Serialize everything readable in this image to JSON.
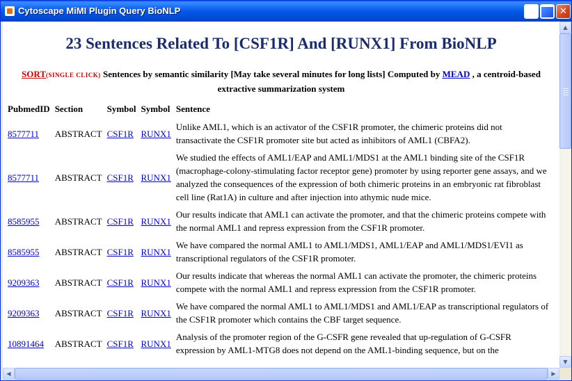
{
  "window": {
    "title": "Cytoscape MiMI Plugin Query BioNLP"
  },
  "page": {
    "heading": "23 Sentences Related To [CSF1R] And [RUNX1] From BioNLP",
    "sort_link": "SORT",
    "sort_note": "(SINGLE CLICK)",
    "sort_text": " Sentences by semantic similarity [May take several minutes for long lists] Computed by ",
    "mead_link": "MEAD",
    "sort_text2": " , a centroid-based extractive summarization system"
  },
  "table": {
    "headers": [
      "PubmedID",
      "Section",
      "Symbol",
      "Symbol",
      "Sentence"
    ],
    "rows": [
      {
        "pmid": "8577711",
        "section": "ABSTRACT",
        "sym1": "CSF1R",
        "sym2": "RUNX1",
        "sentence": "Unlike AML1, which is an activator of the CSF1R promoter, the chimeric proteins did not transactivate the CSF1R promoter site but acted as inhibitors of AML1 (CBFA2)."
      },
      {
        "pmid": "8577711",
        "section": "ABSTRACT",
        "sym1": "CSF1R",
        "sym2": "RUNX1",
        "sentence": "We studied the effects of AML1/EAP and AML1/MDS1 at the AML1 binding site of the CSF1R (macrophage-colony-stimulating factor receptor gene) promoter by using reporter gene assays, and we analyzed the consequences of the expression of both chimeric proteins in an embryonic rat fibroblast cell line (Rat1A) in culture and after injection into athymic nude mice."
      },
      {
        "pmid": "8585955",
        "section": "ABSTRACT",
        "sym1": "CSF1R",
        "sym2": "RUNX1",
        "sentence": "Our results indicate that AML1 can activate the promoter, and that the chimeric proteins compete with the normal AML1 and repress expression from the CSF1R promoter."
      },
      {
        "pmid": "8585955",
        "section": "ABSTRACT",
        "sym1": "CSF1R",
        "sym2": "RUNX1",
        "sentence": "We have compared the normal AML1 to AML1/MDS1, AML1/EAP and AML1/MDS1/EVI1 as transcriptional regulators of the CSF1R promoter."
      },
      {
        "pmid": "9209363",
        "section": "ABSTRACT",
        "sym1": "CSF1R",
        "sym2": "RUNX1",
        "sentence": "Our results indicate that whereas the normal AML1 can activate the promoter, the chimeric proteins compete with the normal AML1 and repress expression from the CSF1R promoter."
      },
      {
        "pmid": "9209363",
        "section": "ABSTRACT",
        "sym1": "CSF1R",
        "sym2": "RUNX1",
        "sentence": "We have compared the normal AML1 to AML1/MDS1 and AML1/EAP as transcriptional regulators of the CSF1R promoter which contains the CBF target sequence."
      },
      {
        "pmid": "10891464",
        "section": "ABSTRACT",
        "sym1": "CSF1R",
        "sym2": "RUNX1",
        "sentence": "Analysis of the promoter region of the G-CSFR gene revealed that up-regulation of G-CSFR expression by AML1-MTG8 does not depend on the AML1-binding sequence, but on the"
      }
    ]
  }
}
